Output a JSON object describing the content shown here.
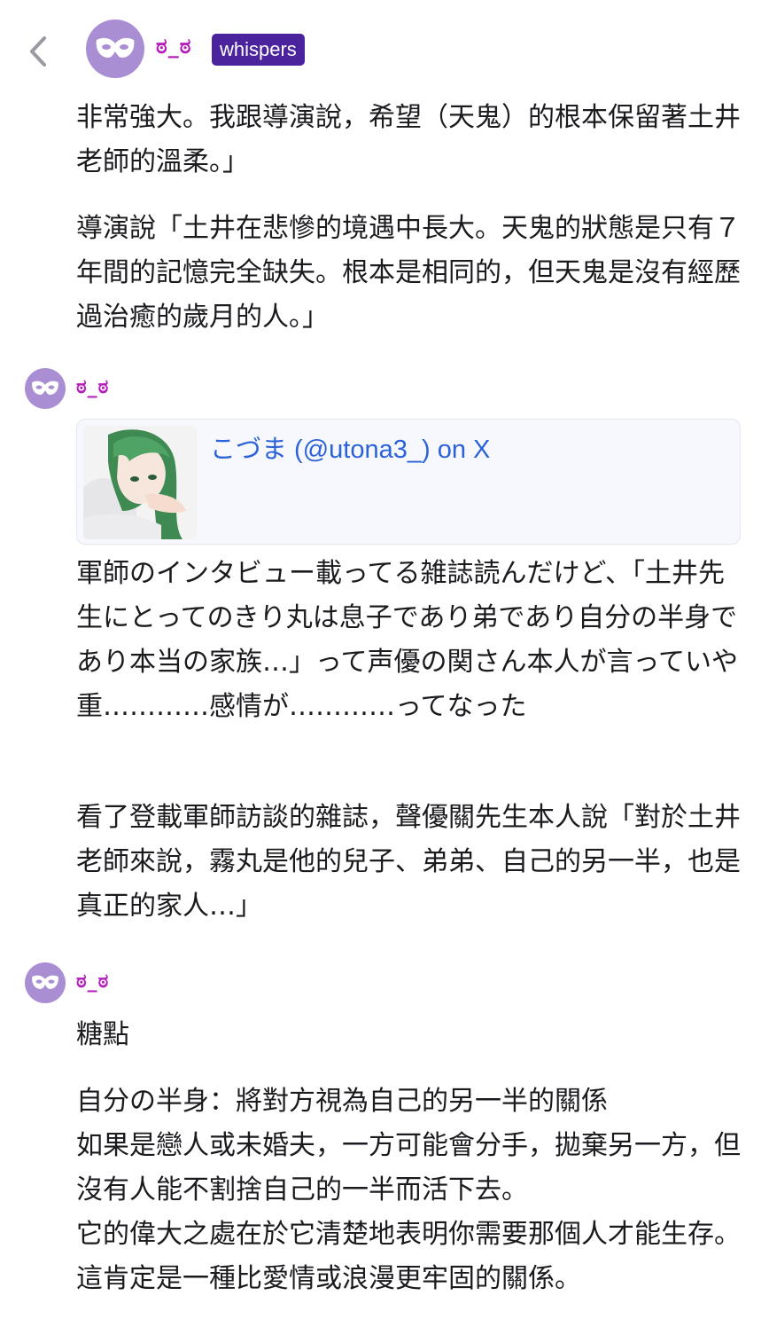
{
  "header": {
    "username": "ಠ_ಠ",
    "badge": "whispers"
  },
  "posts": [
    {
      "paragraphs": [
        "非常強大。我跟導演說，希望（天鬼）的根本保留著土井老師的溫柔。」",
        "導演說「土井在悲慘的境遇中長大。天鬼的狀態是只有７年間的記憶完全缺失。根本是相同的，但天鬼是沒有經歷過治癒的歲月的人。」"
      ]
    },
    {
      "username": "ಠ_ಠ",
      "embed": {
        "title": "こづま (@utona3_) on X",
        "thumbnail_icon": "anime-girl-green-hair-thumbnail"
      },
      "paragraphs": [
        "軍師のインタビュー載ってる雑誌読んだけど、「土井先生にとってのきり丸は息子であり弟であり自分の半身であり本当の家族…」って声優の関さん本人が言っていや重…………感情が…………ってなった",
        "看了登載軍師訪談的雜誌，聲優關先生本人說「對於土井老師來說，霧丸是他的兒子、弟弟、自己的另一半，也是真正的家人…」"
      ]
    },
    {
      "username": "ಠ_ಠ",
      "paragraphs": [
        "糖點",
        "自分の半身：將對方視為自己的另一半的關係\n如果是戀人或未婚夫，一方可能會分手，拋棄另一方，但沒有人能不割捨自己的一半而活下去。\n它的偉大之處在於它清楚地表明你需要那個人才能生存。這肯定是一種比愛情或浪漫更牢固的關係。"
      ]
    }
  ],
  "colors": {
    "avatar": "#a98ed3",
    "username": "#b51fbc",
    "badge_bg": "#4a239d",
    "link": "#2b62d8"
  }
}
